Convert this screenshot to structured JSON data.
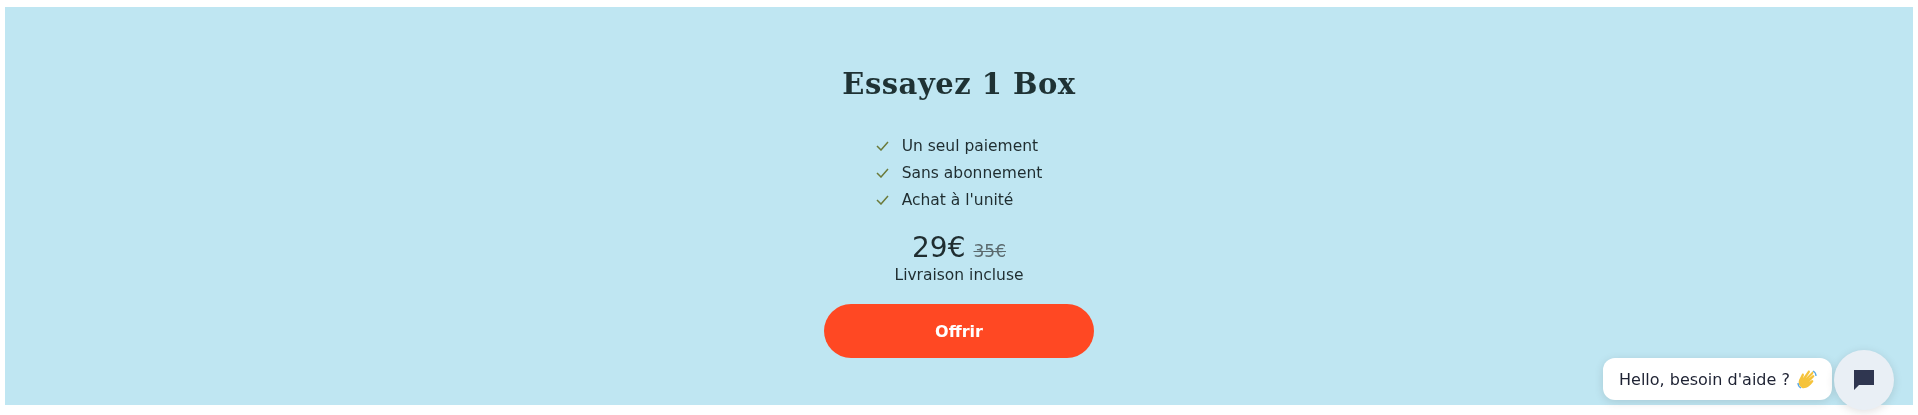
{
  "offer": {
    "title": "Essayez 1 Box",
    "features": [
      "Un seul paiement",
      "Sans abonnement",
      "Achat à l'unité"
    ],
    "price": "29€",
    "old_price": "35€",
    "delivery": "Livraison incluse",
    "button": "Offrir"
  },
  "chat": {
    "greeting": "Hello, besoin d'aide ?"
  }
}
